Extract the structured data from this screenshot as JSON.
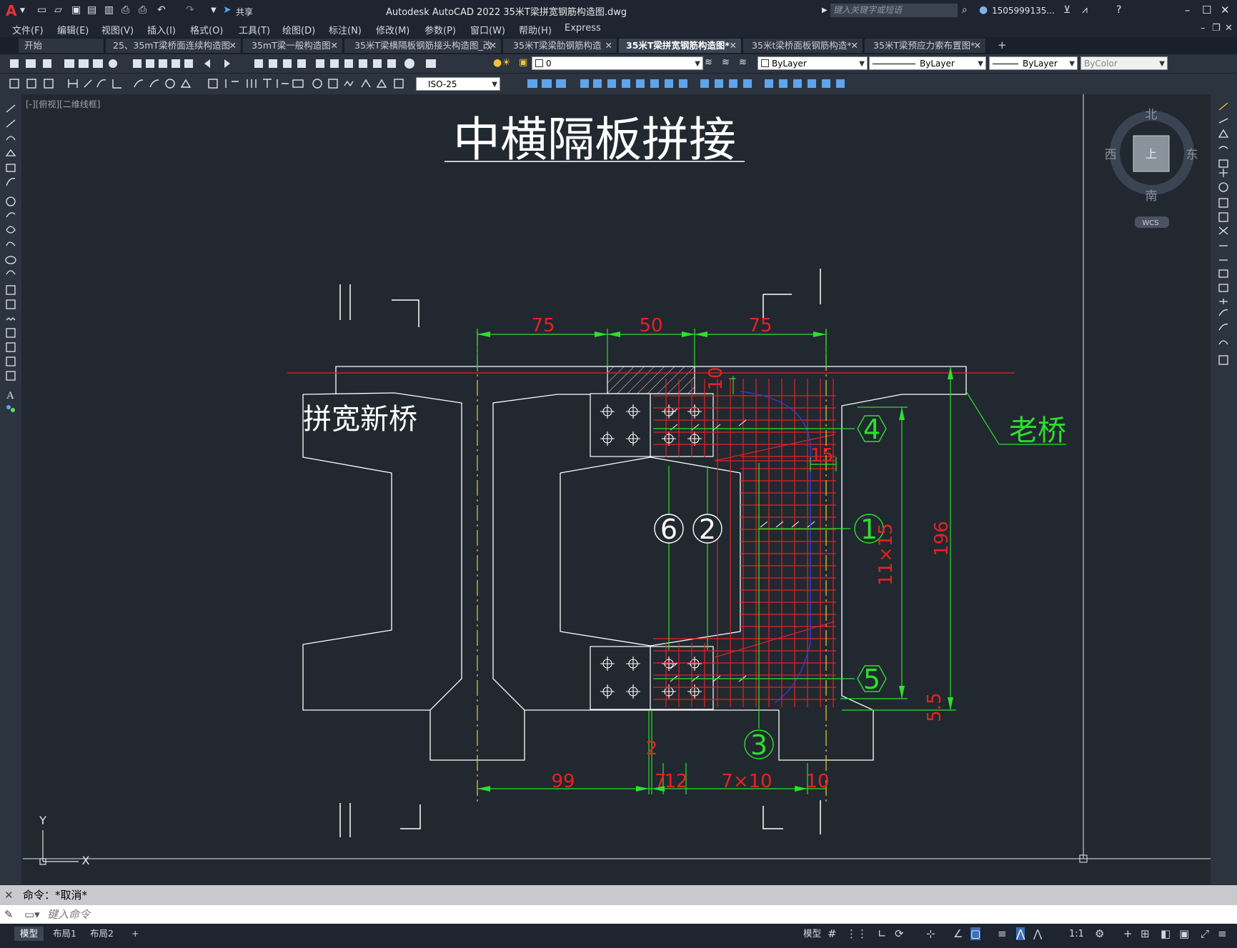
{
  "app": {
    "window_title": "Autodesk AutoCAD 2022    35米T梁拼宽钢筋构造图.dwg",
    "share_label": "共享",
    "search_placeholder": "键入关键字或短语",
    "user": "1505999135...",
    "logo": "A"
  },
  "menus": [
    "文件(F)",
    "编辑(E)",
    "视图(V)",
    "插入(I)",
    "格式(O)",
    "工具(T)",
    "绘图(D)",
    "标注(N)",
    "修改(M)",
    "参数(P)",
    "窗口(W)",
    "帮助(H)",
    "Express"
  ],
  "tabs": [
    {
      "label": "开始",
      "closable": false,
      "active": false
    },
    {
      "label": "25、35mT梁桥面连续构造图",
      "closable": true,
      "active": false
    },
    {
      "label": "35mT梁一般构造图",
      "closable": true,
      "active": false
    },
    {
      "label": "35米T梁横隔板钢筋接头构造图_改",
      "closable": true,
      "active": false
    },
    {
      "label": "35米T梁梁肋钢筋构造",
      "closable": true,
      "active": false
    },
    {
      "label": "35米T梁拼宽钢筋构造图*",
      "closable": true,
      "active": true
    },
    {
      "label": "35米t梁桥面板钢筋构造*",
      "closable": true,
      "active": false
    },
    {
      "label": "35米T梁预应力索布置图*",
      "closable": true,
      "active": false
    }
  ],
  "toolbar": {
    "layer_value": "0",
    "color_value": "ByLayer",
    "linetype_value": "ByLayer",
    "lineweight_value": "ByLayer",
    "plotstyle_value": "ByColor",
    "dimstyle_value": "ISO-25"
  },
  "viewport": {
    "controls": "[-][俯视][二维线框]",
    "viewcube": {
      "north": "北",
      "south": "南",
      "east": "东",
      "west": "西",
      "face": "上",
      "wcs": "WCS"
    },
    "ucs": {
      "x": "X",
      "y": "Y"
    }
  },
  "drawing": {
    "title": "中横隔板拼接",
    "label_new": "拼宽新桥",
    "label_old": "老桥",
    "dims_top": [
      "75",
      "50",
      "75"
    ],
    "dims_bottom": [
      "99",
      "7",
      "12",
      "7×10",
      "10"
    ],
    "dim_small_2": "2",
    "dim_10": "10",
    "dim_15": "15",
    "dim_11x15": "11×15",
    "dim_196": "196",
    "dim_55": "5.5",
    "callouts": [
      "4",
      "1",
      "5",
      "6",
      "2",
      "3"
    ]
  },
  "command": {
    "history": "命令：*取消*",
    "placeholder": "键入命令"
  },
  "status": {
    "layout_tabs": [
      "模型",
      "布局1",
      "布局2"
    ],
    "model_label": "模型",
    "scale": "1:1"
  }
}
